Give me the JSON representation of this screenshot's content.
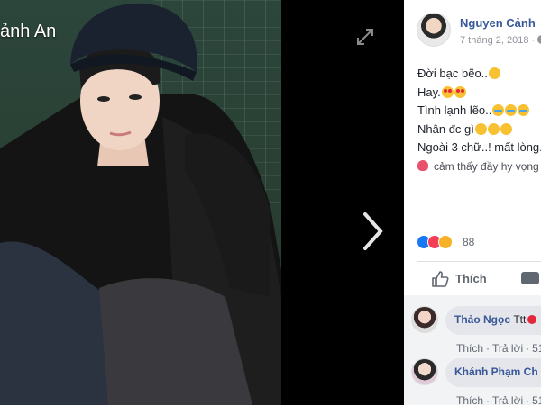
{
  "viewer": {
    "photo_caption": "ảnh An",
    "expand_icon": "expand-icon",
    "next_icon": "chevron-right-icon"
  },
  "post": {
    "author": "Nguyen Cảnh",
    "date": "7 tháng 2, 2018 ·",
    "lines": [
      "Đời bạc bẽo..",
      "Hay.",
      "Tình lạnh lẽo..",
      "Nhân đc gì",
      "Ngoài 3 chữ..! mất lòng..",
      "cảm thấy đầy hy vọng"
    ],
    "reactions": {
      "icons": [
        "like-icon",
        "love-icon",
        "wow-icon"
      ],
      "count": "88"
    },
    "actions": {
      "like_label": "Thích"
    }
  },
  "comments": [
    {
      "name": "Thảo Ngọc",
      "trailing": "Ttt",
      "actions": [
        "Thích",
        "·",
        "Trả lời",
        "·",
        "51"
      ]
    },
    {
      "name": "Khánh Phạm Ch",
      "trailing": "",
      "actions": [
        "Thích",
        "·",
        "Trả lời",
        "·",
        "51"
      ]
    }
  ],
  "colors": {
    "link_blue": "#385898",
    "like_blue": "#1877f2",
    "text": "#1d2129",
    "muted": "#90949c"
  }
}
